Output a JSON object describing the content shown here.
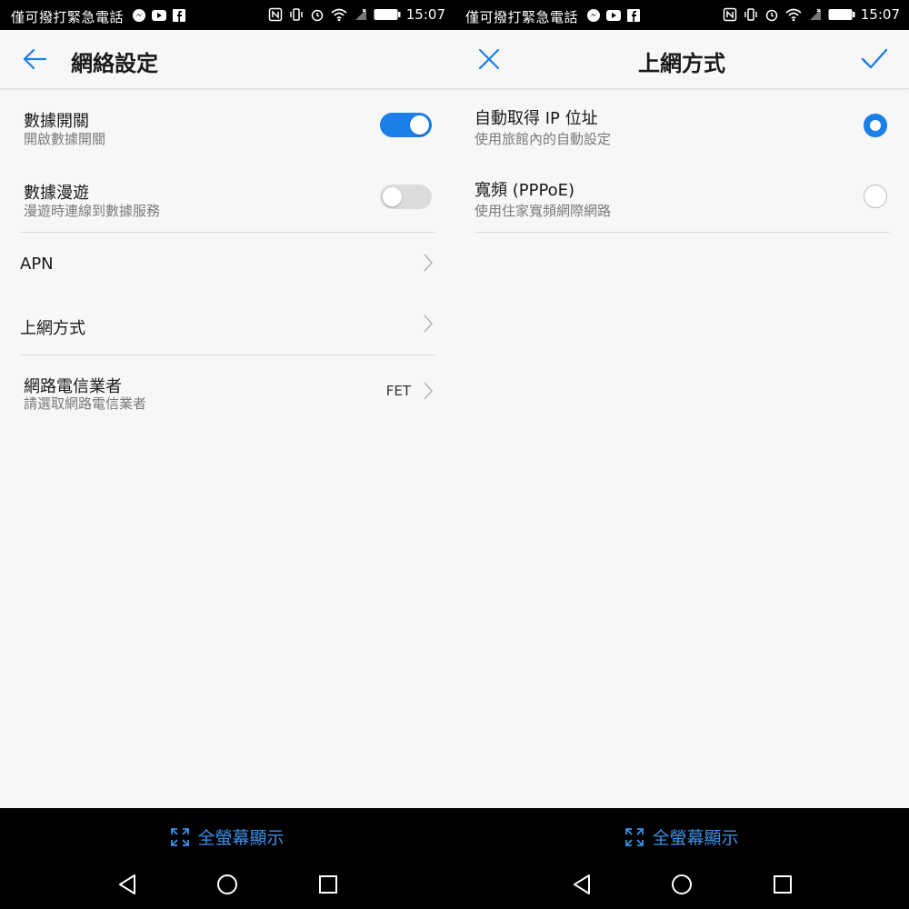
{
  "status_bar": {
    "notice": "僅可撥打緊急電話",
    "time": "15:07"
  },
  "left_panel": {
    "title": "網絡設定",
    "rows": [
      {
        "title": "數據開關",
        "subtitle": "開啟數據開關",
        "toggle": "on"
      },
      {
        "title": "數據漫遊",
        "subtitle": "漫遊時連線到數據服務",
        "toggle": "off"
      },
      {
        "title": "APN"
      },
      {
        "title": "上網方式"
      },
      {
        "title": "網路電信業者",
        "subtitle": "請選取網路電信業者",
        "value": "FET"
      }
    ]
  },
  "right_panel": {
    "title": "上網方式",
    "options": [
      {
        "title": "自動取得 IP 位址",
        "subtitle": "使用旅館內的自動設定",
        "selected": true
      },
      {
        "title": "寬頻 (PPPoE)",
        "subtitle": "使用住家寬頻網際網路",
        "selected": false
      }
    ]
  },
  "bottom": {
    "fullscreen_label": "全螢幕顯示"
  },
  "colors": {
    "accent": "#1a7fe6",
    "background": "#f7f7f7"
  }
}
